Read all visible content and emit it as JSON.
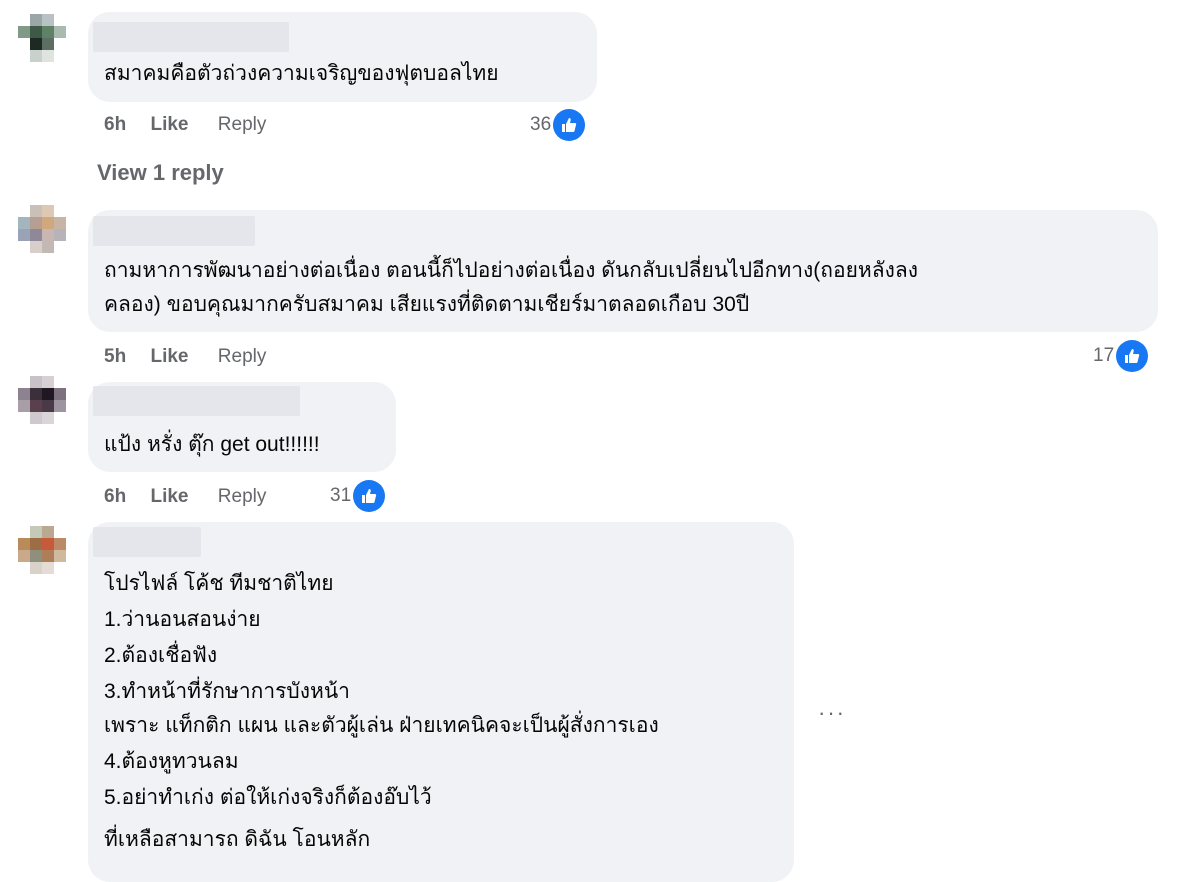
{
  "comments": [
    {
      "text": "สมาคมคือตัวถ่วงความเจริญของฟุตบอลไทย",
      "time": "6h",
      "like": "Like",
      "reply": "Reply",
      "reactions": "36"
    },
    {
      "text": "ถามหาการพัฒนาอย่างต่อเนื่อง ตอนนี้ก็ไปอย่างต่อเนื่อง ดันกลับเปลี่ยนไปอีกทาง(ถอยหลังลง",
      "text2": "คลอง) ขอบคุณมากครับสมาคม เสียแรงที่ติดตามเชียร์มาตลอดเกือบ 30ปี",
      "time": "5h",
      "like": "Like",
      "reply": "Reply",
      "reactions": "17"
    },
    {
      "text": "แป้ง หรั่ง ตุ๊ก get out!!!!!!",
      "time": "6h",
      "like": "Like",
      "reply": "Reply",
      "reactions": "31"
    },
    {
      "lines": [
        "โปรไฟล์ โค้ช ทีมชาติไทย",
        "1.ว่านอนสอนง่าย",
        "2.ต้องเชื่อฟัง",
        "3.ทำหน้าที่รักษาการบังหน้า",
        "เพราะ แท็กติก แผน และตัวผู้เล่น ฝ่ายเทคนิคจะเป็นผู้สั่งการเอง",
        "4.ต้องหูทวนลม",
        "5.อย่าทำเก่ง ต่อให้เก่งจริงก็ต้องอ๊บไว้",
        "ที่เหลือสามารถ ดิฉัน โอนหลัก"
      ]
    }
  ],
  "view_replies": "View 1 reply",
  "more_options": "···",
  "colors": {
    "like_blue": "#1877f2",
    "bubble": "#f0f2f5",
    "meta": "#65676b"
  },
  "icons": {
    "reaction": "like-thumb-icon"
  }
}
